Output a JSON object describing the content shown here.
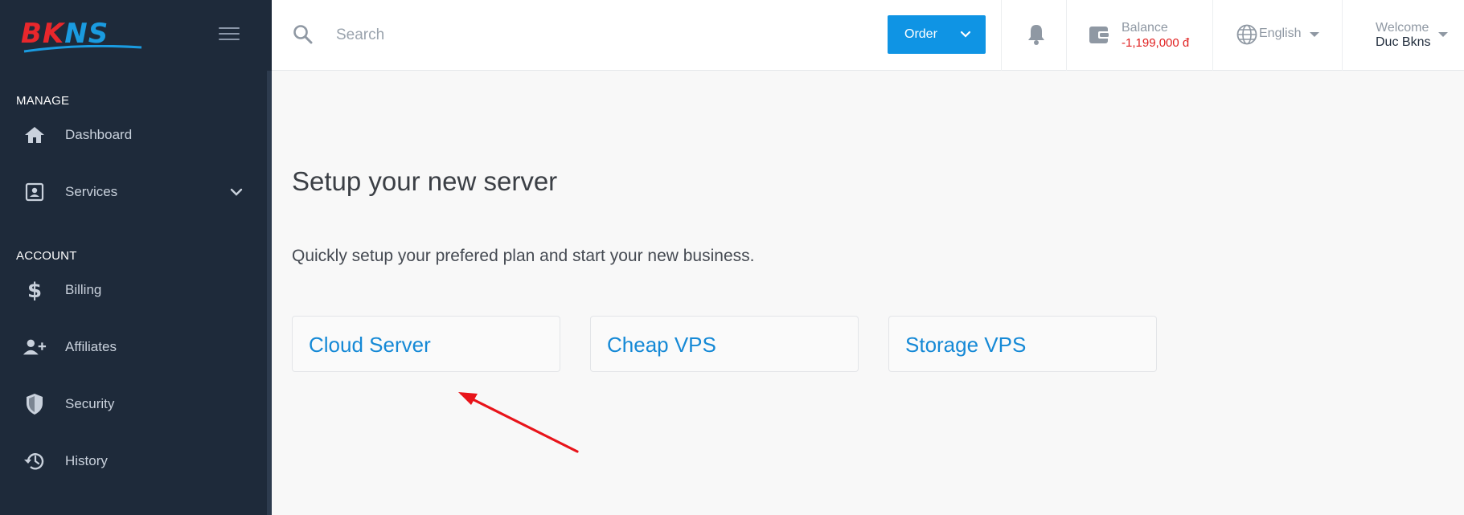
{
  "brand": {
    "logo_text_red": "BK",
    "logo_text_blue": "NS",
    "colors": {
      "red": "#e8272c",
      "blue": "#1a9be0",
      "sidebar": "#1e2a3a",
      "accent": "#0f94e4"
    }
  },
  "sidebar": {
    "manage_label": "MANAGE",
    "account_label": "ACCOUNT",
    "items": [
      {
        "label": "Dashboard",
        "icon": "home-icon"
      },
      {
        "label": "Services",
        "icon": "id-card-icon"
      },
      {
        "label": "Billing",
        "icon": "dollar-icon"
      },
      {
        "label": "Affiliates",
        "icon": "user-plus-icon"
      },
      {
        "label": "Security",
        "icon": "shield-icon"
      },
      {
        "label": "History",
        "icon": "history-icon"
      }
    ]
  },
  "header": {
    "search_placeholder": "Search",
    "order_label": "Order",
    "balance_label": "Balance",
    "balance_value": "-1,199,000 đ",
    "language": "English",
    "welcome_label": "Welcome",
    "user_name": "Duc Bkns"
  },
  "main": {
    "title": "Setup your new server",
    "subtitle": "Quickly setup your prefered plan and start your new business.",
    "plans": [
      "Cloud Server",
      "Cheap VPS",
      "Storage VPS"
    ]
  }
}
